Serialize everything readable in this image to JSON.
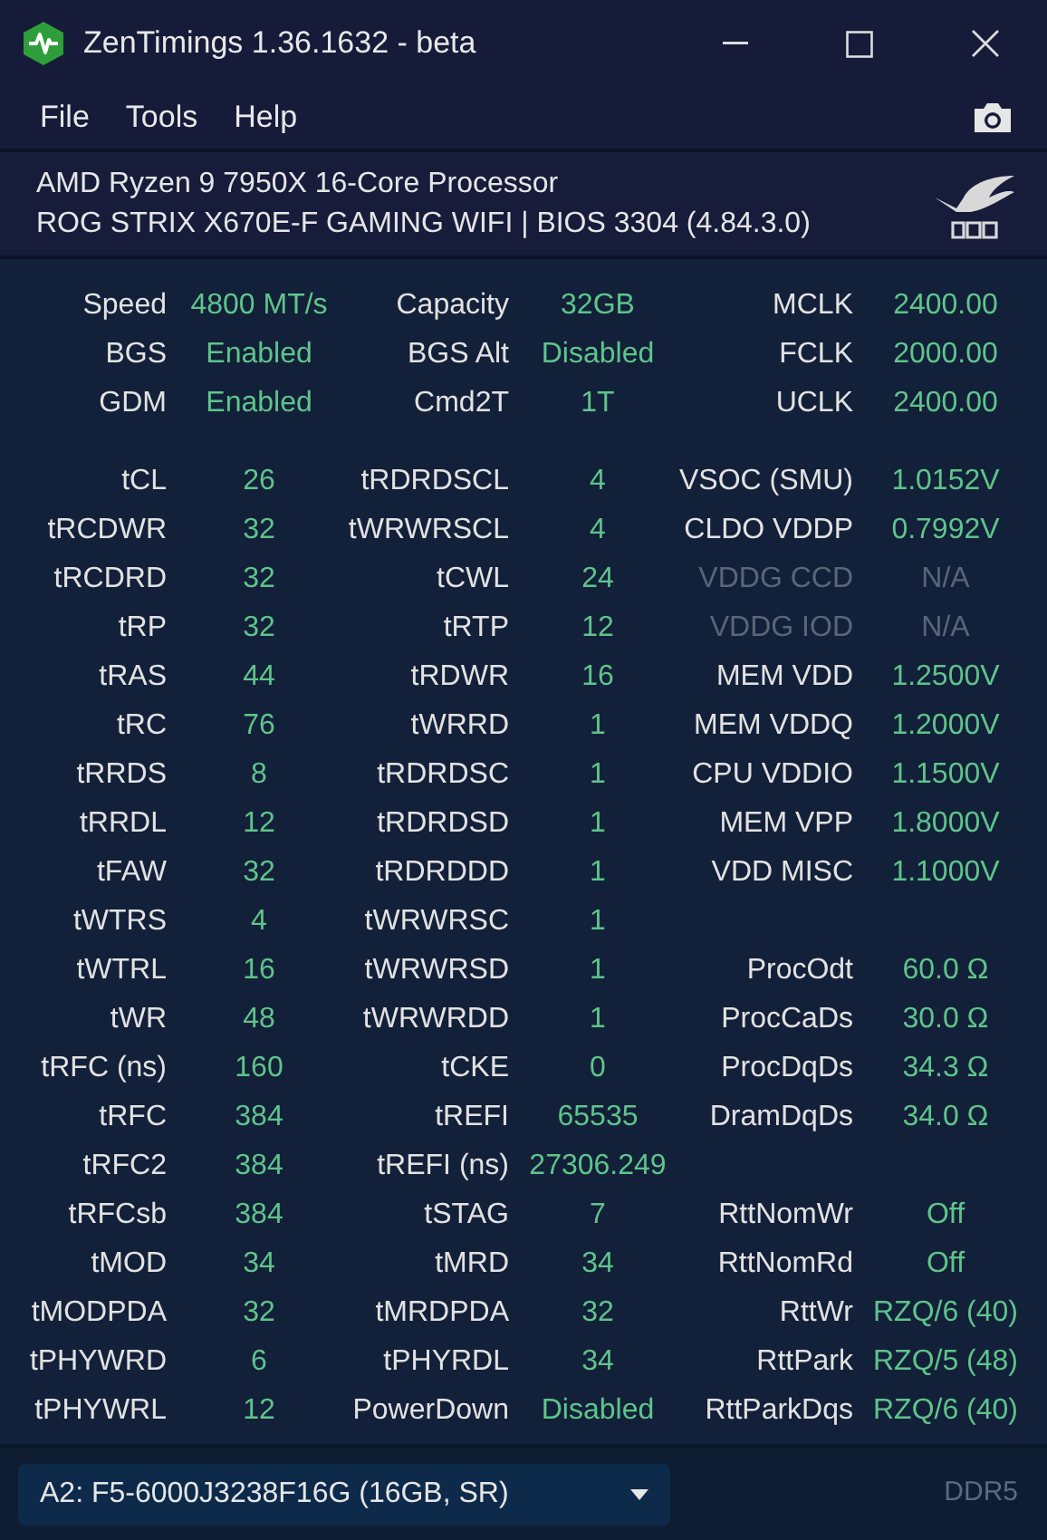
{
  "window": {
    "title": "ZenTimings 1.36.1632 - beta"
  },
  "menu": [
    "File",
    "Tools",
    "Help"
  ],
  "system": {
    "cpu": "AMD Ryzen 9 7950X 16-Core Processor",
    "board": "ROG STRIX X670E-F GAMING WIFI | BIOS 3304 (4.84.3.0)"
  },
  "summary": [
    {
      "label": "Speed",
      "value": "4800 MT/s"
    },
    {
      "label": "Capacity",
      "value": "32GB"
    },
    {
      "label": "MCLK",
      "value": "2400.00"
    },
    {
      "label": "BGS",
      "value": "Enabled"
    },
    {
      "label": "BGS Alt",
      "value": "Disabled"
    },
    {
      "label": "FCLK",
      "value": "2000.00"
    },
    {
      "label": "GDM",
      "value": "Enabled"
    },
    {
      "label": "Cmd2T",
      "value": "1T"
    },
    {
      "label": "UCLK",
      "value": "2400.00"
    }
  ],
  "column_1": [
    {
      "label": "tCL",
      "value": "26"
    },
    {
      "label": "tRCDWR",
      "value": "32"
    },
    {
      "label": "tRCDRD",
      "value": "32"
    },
    {
      "label": "tRP",
      "value": "32"
    },
    {
      "label": "tRAS",
      "value": "44"
    },
    {
      "label": "tRC",
      "value": "76"
    },
    {
      "label": "tRRDS",
      "value": "8"
    },
    {
      "label": "tRRDL",
      "value": "12"
    },
    {
      "label": "tFAW",
      "value": "32"
    },
    {
      "label": "tWTRS",
      "value": "4"
    },
    {
      "label": "tWTRL",
      "value": "16"
    },
    {
      "label": "tWR",
      "value": "48"
    },
    {
      "label": "tRFC (ns)",
      "value": "160"
    },
    {
      "label": "tRFC",
      "value": "384"
    },
    {
      "label": "tRFC2",
      "value": "384"
    },
    {
      "label": "tRFCsb",
      "value": "384"
    },
    {
      "label": "tMOD",
      "value": "34"
    },
    {
      "label": "tMODPDA",
      "value": "32"
    },
    {
      "label": "tPHYWRD",
      "value": "6"
    },
    {
      "label": "tPHYWRL",
      "value": "12"
    }
  ],
  "column_2": [
    {
      "label": "tRDRDSCL",
      "value": "4"
    },
    {
      "label": "tWRWRSCL",
      "value": "4"
    },
    {
      "label": "tCWL",
      "value": "24"
    },
    {
      "label": "tRTP",
      "value": "12"
    },
    {
      "label": "tRDWR",
      "value": "16"
    },
    {
      "label": "tWRRD",
      "value": "1"
    },
    {
      "label": "tRDRDSC",
      "value": "1"
    },
    {
      "label": "tRDRDSD",
      "value": "1"
    },
    {
      "label": "tRDRDDD",
      "value": "1"
    },
    {
      "label": "tWRWRSC",
      "value": "1"
    },
    {
      "label": "tWRWRSD",
      "value": "1"
    },
    {
      "label": "tWRWRDD",
      "value": "1"
    },
    {
      "label": "tCKE",
      "value": "0"
    },
    {
      "label": "tREFI",
      "value": "65535"
    },
    {
      "label": "tREFI (ns)",
      "value": "27306.249"
    },
    {
      "label": "tSTAG",
      "value": "7"
    },
    {
      "label": "tMRD",
      "value": "34"
    },
    {
      "label": "tMRDPDA",
      "value": "32"
    },
    {
      "label": "tPHYRDL",
      "value": "34"
    },
    {
      "label": "PowerDown",
      "value": "Disabled"
    }
  ],
  "column_3": [
    [
      {
        "label": "VSOC (SMU)",
        "value": "1.0152V",
        "disabled": false
      },
      {
        "label": "CLDO VDDP",
        "value": "0.7992V",
        "disabled": false
      },
      {
        "label": "VDDG CCD",
        "value": "N/A",
        "disabled": true
      },
      {
        "label": "VDDG IOD",
        "value": "N/A",
        "disabled": true
      },
      {
        "label": "MEM VDD",
        "value": "1.2500V",
        "disabled": false
      },
      {
        "label": "MEM VDDQ",
        "value": "1.2000V",
        "disabled": false
      },
      {
        "label": "CPU VDDIO",
        "value": "1.1500V",
        "disabled": false
      },
      {
        "label": "MEM VPP",
        "value": "1.8000V",
        "disabled": false
      },
      {
        "label": "VDD MISC",
        "value": "1.1000V",
        "disabled": false
      }
    ],
    [
      {
        "label": "ProcOdt",
        "value": "60.0 Ω",
        "disabled": false
      },
      {
        "label": "ProcCaDs",
        "value": "30.0 Ω",
        "disabled": false
      },
      {
        "label": "ProcDqDs",
        "value": "34.3 Ω",
        "disabled": false
      },
      {
        "label": "DramDqDs",
        "value": "34.0 Ω",
        "disabled": false
      }
    ],
    [
      {
        "label": "RttNomWr",
        "value": "Off",
        "disabled": false
      },
      {
        "label": "RttNomRd",
        "value": "Off",
        "disabled": false
      },
      {
        "label": "RttWr",
        "value": "RZQ/6 (40)",
        "disabled": false
      },
      {
        "label": "RttPark",
        "value": "RZQ/5 (48)",
        "disabled": false
      },
      {
        "label": "RttParkDqs",
        "value": "RZQ/6 (40)",
        "disabled": false
      }
    ]
  ],
  "footer": {
    "module": "A2: F5-6000J3238F16G (16GB, SR)",
    "memory_type": "DDR5"
  }
}
